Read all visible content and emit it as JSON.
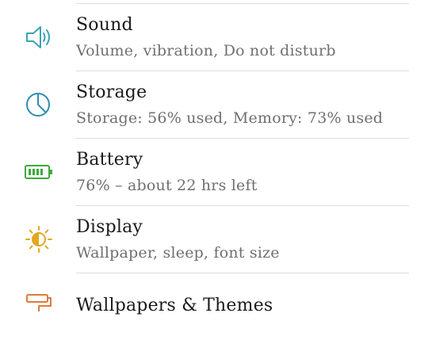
{
  "settings": {
    "items": [
      {
        "title": "Sound",
        "subtitle": "Volume, vibration, Do not disturb",
        "icon": "speaker-icon",
        "color": "#3aa5b2"
      },
      {
        "title": "Storage",
        "subtitle": "Storage: 56% used, Memory: 73% used",
        "icon": "storage-pie-icon",
        "color": "#2f8fb0"
      },
      {
        "title": "Battery",
        "subtitle": "76% – about 22 hrs left",
        "icon": "battery-icon",
        "color": "#3faa3c"
      },
      {
        "title": "Display",
        "subtitle": "Wallpaper, sleep, font size",
        "icon": "brightness-icon",
        "color": "#e0a81f"
      },
      {
        "title": "Wallpapers & Themes",
        "subtitle": "",
        "icon": "paint-roller-icon",
        "color": "#e07a3a"
      }
    ]
  }
}
